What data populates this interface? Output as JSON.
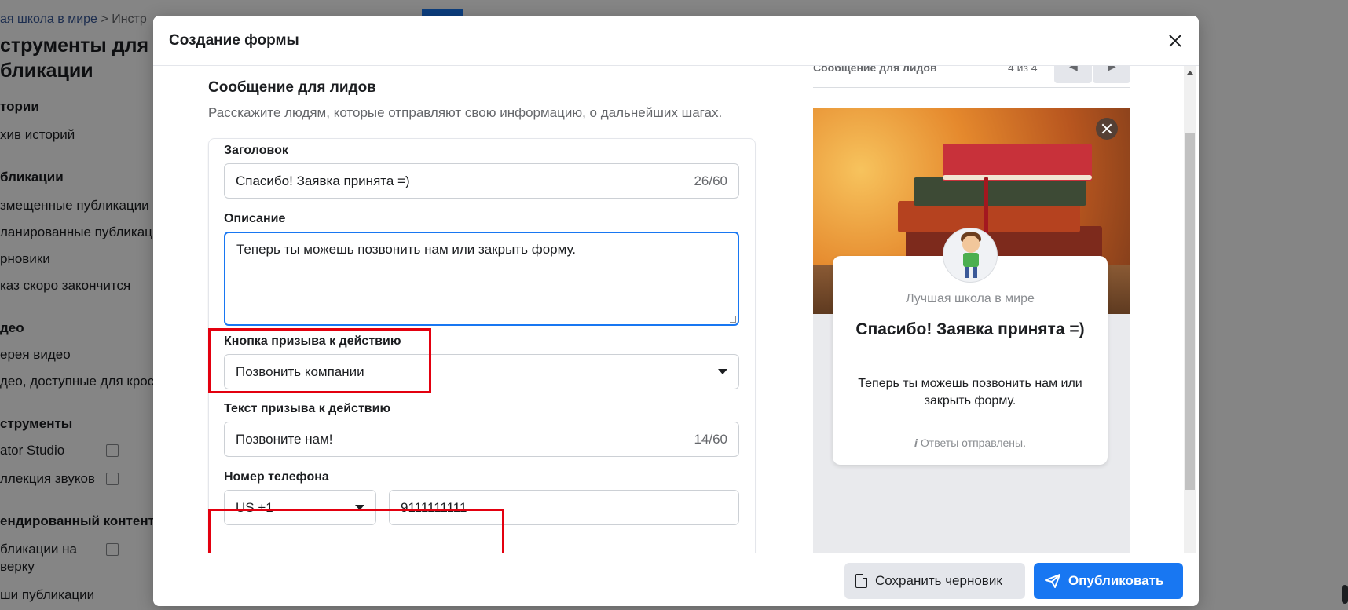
{
  "background": {
    "breadcrumb_link": "ая школа в мире",
    "breadcrumb_sep": ">",
    "breadcrumb_current": "Инстр",
    "page_title": "струменты для бликации",
    "sidebar": [
      {
        "kind": "section",
        "label": "тории"
      },
      {
        "kind": "item",
        "label": "хив историй"
      },
      {
        "kind": "section",
        "label": "бликации"
      },
      {
        "kind": "item",
        "label": "змещенные публикации"
      },
      {
        "kind": "item",
        "label": "ланированные публикации"
      },
      {
        "kind": "item",
        "label": "рновики"
      },
      {
        "kind": "item",
        "label": "каз скоро закончится"
      },
      {
        "kind": "section",
        "label": "део"
      },
      {
        "kind": "item",
        "label": "ерея видео"
      },
      {
        "kind": "item",
        "label": "део, доступные для кросс"
      },
      {
        "kind": "section",
        "label": "струменты"
      },
      {
        "kind": "item",
        "label": "ator Studio"
      },
      {
        "kind": "item",
        "label": "ллекция звуков"
      },
      {
        "kind": "section",
        "label": "ендированный контент"
      },
      {
        "kind": "item",
        "label": "бликации на"
      },
      {
        "kind": "item",
        "label": "верку"
      },
      {
        "kind": "item",
        "label": "ши публикации"
      }
    ]
  },
  "dialog": {
    "title": "Создание формы",
    "section_title": "Сообщение для лидов",
    "section_subtitle": "Расскажите людям, которые отправляют свою информацию, о дальнейших шагах.",
    "fields": {
      "headline_label": "Заголовок",
      "headline_value": "Спасибо! Заявка принята =)",
      "headline_counter": "26/60",
      "description_label": "Описание",
      "description_value": "Теперь ты можешь позвонить нам или закрыть форму.",
      "cta_button_label": "Кнопка призыва к действию",
      "cta_button_value": "Позвонить компании",
      "cta_text_label": "Текст призыва к действию",
      "cta_text_value": "Позвоните нам!",
      "cta_text_counter": "14/60",
      "phone_label": "Номер телефона",
      "phone_country": "US +1",
      "phone_number": "9111111111"
    },
    "preview": {
      "bar_title": "Сообщение для лидов",
      "bar_count": "4 из 4",
      "page_name": "Лучшая школа в мире",
      "headline": "Спасибо! Заявка принята =)",
      "description": "Теперь ты можешь позвонить нам или закрыть форму.",
      "footer": "Ответы отправлены.",
      "info_glyph": "i"
    },
    "footer": {
      "save_draft": "Сохранить черновик",
      "publish": "Опубликовать"
    }
  },
  "colors": {
    "accent": "#1877f2",
    "highlight": "#e3000f",
    "overlay": "rgba(0,0,0,0.48)"
  }
}
